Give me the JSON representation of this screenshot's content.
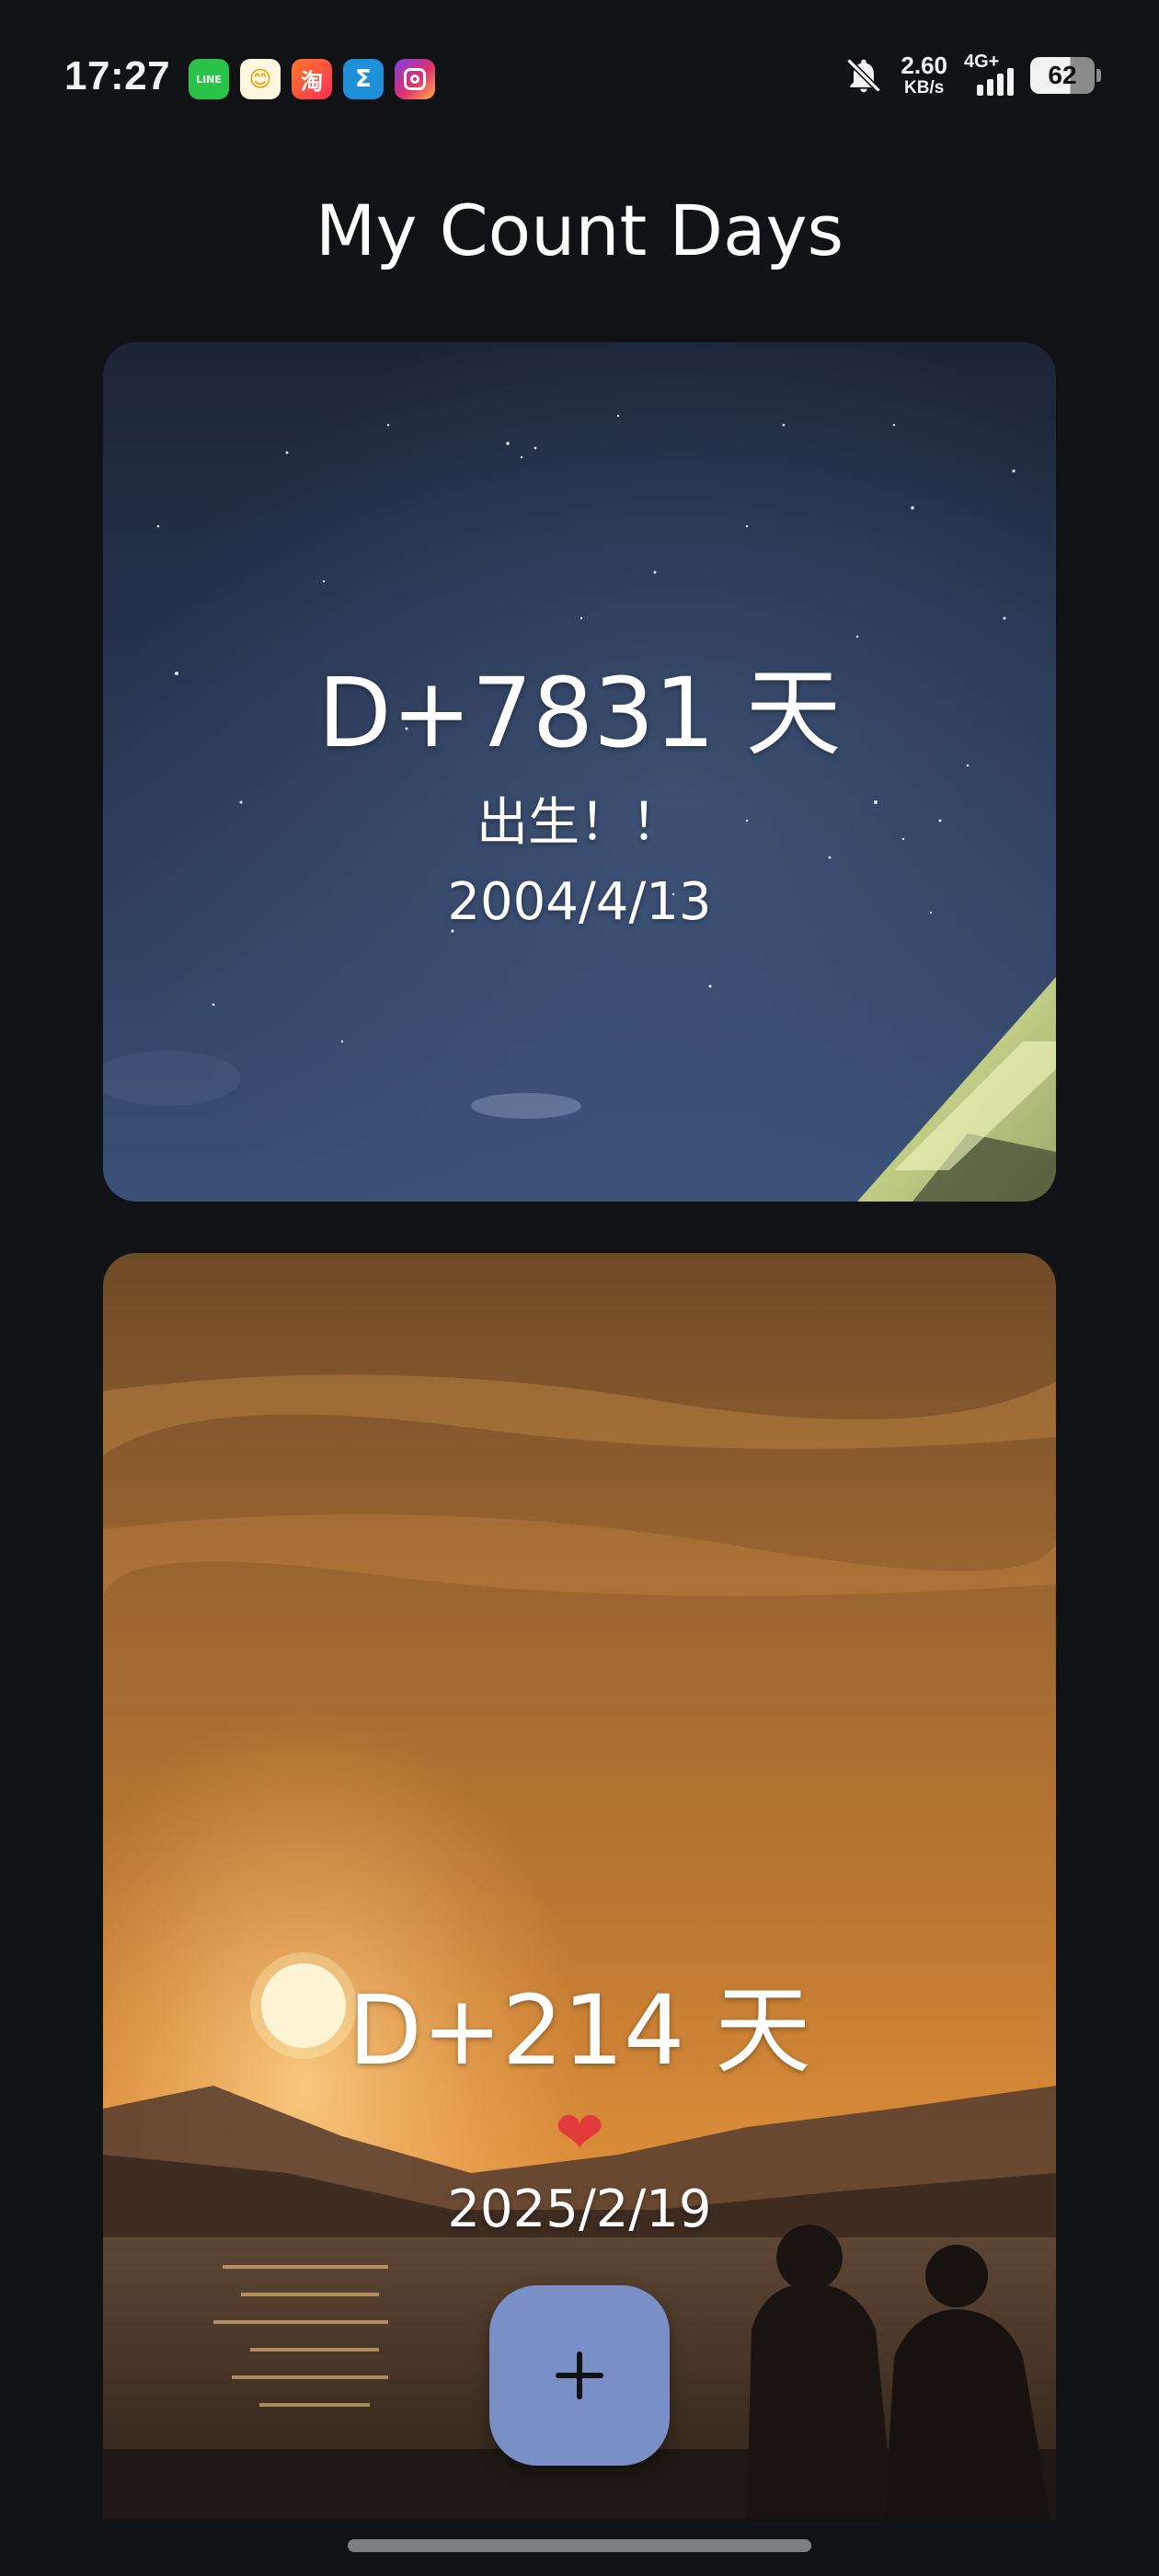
{
  "status_bar": {
    "time": "17:27",
    "notification_icons": [
      "line-icon",
      "baby-face-app-icon",
      "taobao-icon",
      "sigma-app-icon",
      "instagram-icon"
    ],
    "line_text": "LINE",
    "face_glyph": "😊",
    "taobao_glyph": "淘",
    "sigma_glyph": "Σ",
    "mute_icon": "bell-off-icon",
    "net_speed_value": "2.60",
    "net_speed_unit": "KB/s",
    "network_type": "4G+",
    "battery_level": "62"
  },
  "page": {
    "title": "My Count Days"
  },
  "cards": [
    {
      "days_label": "D+7831 天",
      "subtitle": "出生！！",
      "date": "2004/4/13",
      "background": "starry-night-sky-with-building"
    },
    {
      "days_label": "D+214 天",
      "heart_icon": "❤",
      "date": "2025/2/19",
      "background": "sunset-beach-couple"
    }
  ],
  "fab": {
    "icon": "plus-icon"
  },
  "colors": {
    "background": "#111216",
    "fab": "#7b8fc7",
    "heart": "#e23b3b"
  }
}
